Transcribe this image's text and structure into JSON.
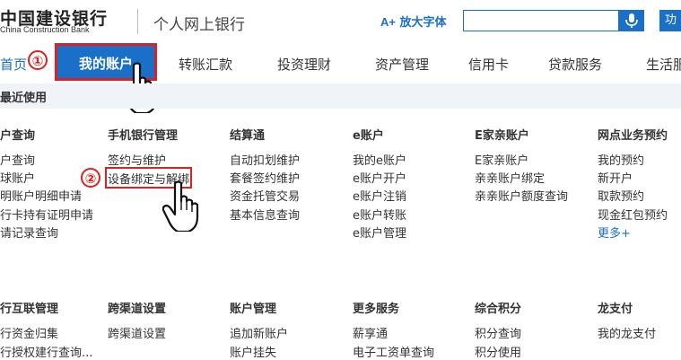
{
  "header": {
    "logo_cn": "中国建设银行",
    "logo_en": "China Construction Bank",
    "subtitle": "个人网上银行",
    "font_button": "放大字体",
    "font_button_icon": "A+",
    "search_placeholder": "",
    "function_button": "功"
  },
  "nav": {
    "home": "首页",
    "active": "我的账户",
    "items": [
      "转账汇款",
      "投资理财",
      "资产管理",
      "信用卡",
      "贷款服务",
      "生活服"
    ]
  },
  "steps": {
    "one": "①",
    "two": "②"
  },
  "recent": {
    "label": "最近使用"
  },
  "section1": {
    "columns": [
      {
        "title": "户查询",
        "links": [
          "户查询",
          "球账户",
          "明账户明细申请",
          "行卡持有证明申请",
          "请记录查询"
        ]
      },
      {
        "title": "手机银行管理",
        "links": [
          "签约与维护",
          "设备绑定与解绑"
        ]
      },
      {
        "title": "结算通",
        "links": [
          "自动扣划维护",
          "套餐签约维护",
          "资金托管交易",
          "基本信息查询"
        ]
      },
      {
        "title": "e账户",
        "links": [
          "我的e账户",
          "e账户开户",
          "e账户注销",
          "e账户转账",
          "e账户管理"
        ]
      },
      {
        "title": "E家亲账户",
        "links": [
          "E家亲账户",
          "亲亲账户绑定",
          "亲亲账户额度查询"
        ]
      },
      {
        "title": "网点业务预约",
        "links": [
          "我的预约",
          "新开户",
          "取款预约",
          "现金红包预约",
          "更多+"
        ]
      }
    ]
  },
  "section2": {
    "columns": [
      {
        "title": "行互联管理",
        "links": [
          "行资金归集",
          "行授权建行查询..."
        ]
      },
      {
        "title": "跨渠道设置",
        "links": [
          "跨渠道设置"
        ]
      },
      {
        "title": "账户管理",
        "links": [
          "追加新账户",
          "账户挂失"
        ]
      },
      {
        "title": "更多服务",
        "links": [
          "薪享通",
          "电子工资单查询"
        ]
      },
      {
        "title": "综合积分",
        "links": [
          "积分查询",
          "积分使用"
        ]
      },
      {
        "title": "龙支付",
        "links": [
          "我的龙支付"
        ]
      }
    ]
  },
  "colors": {
    "accent": "#1a6fc9",
    "annotation": "#e02020"
  }
}
